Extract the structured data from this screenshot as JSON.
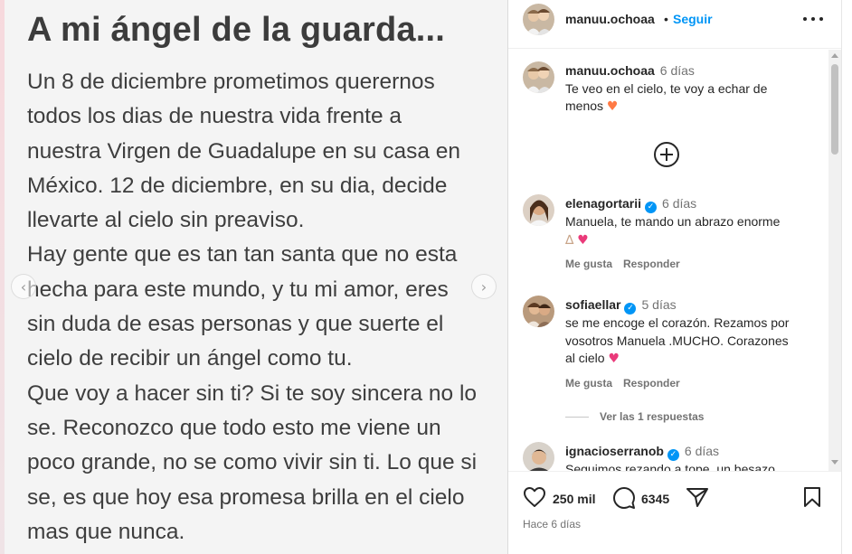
{
  "post": {
    "title": "A mi ángel de la guarda...",
    "lines": [
      "Un 8 de diciembre prometimos querernos",
      "todos los dias de nuestra vida frente a",
      "nuestra Virgen de Guadalupe en su casa en",
      "México. 12 de diciembre, en su dia, decide",
      "llevarte al cielo sin preaviso.",
      "Hay gente que es tan tan santa que no esta",
      "hecha para este mundo, y tu mi amor, eres",
      "sin duda de esas personas y que suerte el",
      "cielo de recibir un ángel como tu.",
      "Que voy a hacer sin ti? Si te soy sincera no lo",
      "se. Reconozco que todo esto me viene un",
      "poco grande, no se como vivir sin ti. Lo que si",
      "se, es que hoy esa promesa brilla en el cielo",
      "mas que nunca."
    ],
    "prev_icon": "chevron-left-icon",
    "next_icon": "chevron-right-icon"
  },
  "header": {
    "username": "manuu.ochoaa",
    "dot": "•",
    "follow_label": "Seguir",
    "more_icon": "more-horizontal-icon"
  },
  "caption": {
    "username": "manuu.ochoaa",
    "time": "6 días",
    "line1": "Te veo en el cielo, te voy a echar de",
    "line2": "menos"
  },
  "load_more_icon": "plus-circle-icon",
  "comments": [
    {
      "username": "elenagortarii",
      "time": "6 días",
      "line1": "Manuela, te mando un abrazo enorme",
      "like_label": "Me gusta",
      "reply_label": "Responder"
    },
    {
      "username": "sofiaellar",
      "time": "5 días",
      "line1": "se me encoge el corazón. Rezamos por",
      "line2": "vosotros Manuela .MUCHO. Corazones",
      "line3": "al cielo",
      "like_label": "Me gusta",
      "reply_label": "Responder"
    },
    {
      "username": "ignacioserranob",
      "time": "6 días",
      "line1": "Seguimos rezando a tope, un besazo"
    }
  ],
  "view_replies_label": "Ver las 1 respuestas",
  "footer": {
    "likes": "250 mil",
    "comments": "6345",
    "date": "Hace 6 días",
    "icons": [
      "heart-icon",
      "comment-icon",
      "share-icon",
      "bookmark-icon"
    ]
  },
  "colors": {
    "link_blue": "#0095f6",
    "muted_text": "#737373",
    "heart_orange": "#ff7a45",
    "heart_pink": "#ea3a7a"
  }
}
